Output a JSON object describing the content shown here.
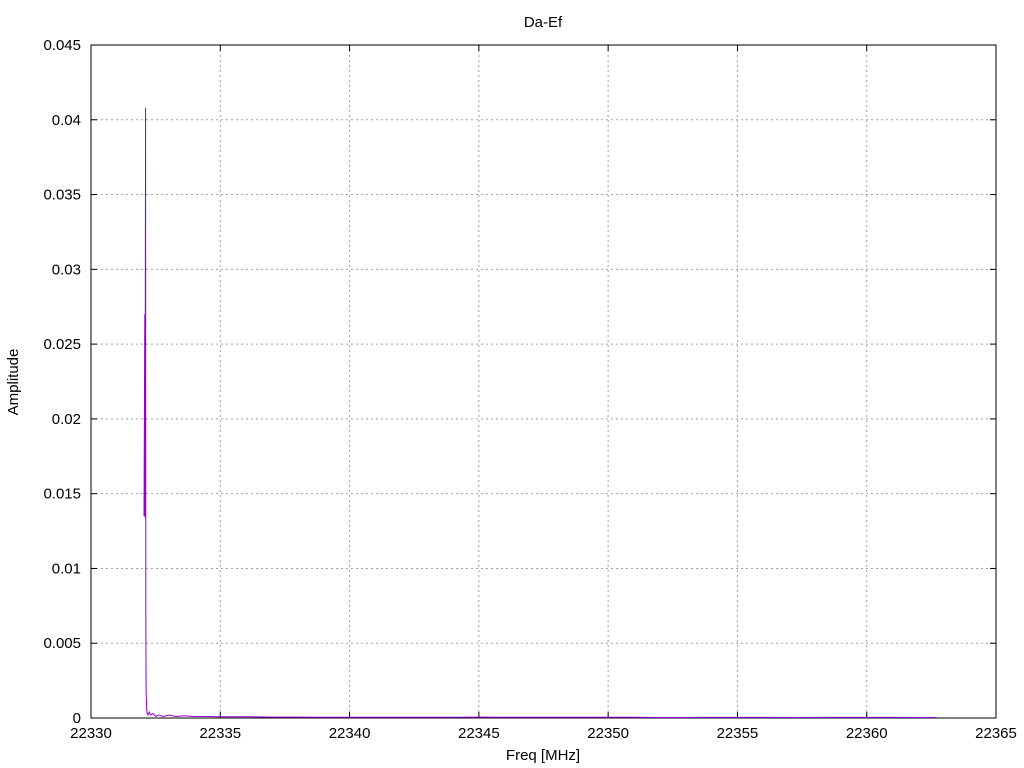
{
  "chart_data": {
    "type": "line",
    "title": "Da-Ef",
    "xlabel": "Freq [MHz]",
    "ylabel": "Amplitude",
    "xlim": [
      22330,
      22365
    ],
    "ylim": [
      0,
      0.045
    ],
    "xticks": [
      22330,
      22335,
      22340,
      22345,
      22350,
      22355,
      22360,
      22365
    ],
    "xtick_labels": [
      "22330",
      "22335",
      "22340",
      "22345",
      "22350",
      "22355",
      "22360",
      "22365"
    ],
    "yticks": [
      0,
      0.005,
      0.01,
      0.015,
      0.02,
      0.025,
      0.03,
      0.035,
      0.04,
      0.045
    ],
    "ytick_labels": [
      "0",
      "0.005",
      "0.01",
      "0.015",
      "0.02",
      "0.025",
      "0.03",
      "0.035",
      "0.04",
      "0.045"
    ],
    "grid": true,
    "line_color": "#9400d3",
    "series": [
      {
        "x": [
          22332.05,
          22332.08,
          22332.09,
          22332.11,
          22332.12,
          22332.13,
          22332.15,
          22332.16,
          22332.18,
          22332.2,
          22332.25,
          22332.3,
          22332.4,
          22332.5,
          22332.6,
          22332.8,
          22333.0,
          22333.3,
          22333.6,
          22334.0,
          22334.5,
          22335.0,
          22336.0,
          22337.0,
          22338.0,
          22339.0,
          22340.0,
          22341.0,
          22342.0,
          22343.0,
          22344.0,
          22345.0,
          22346.0,
          22347.0,
          22348.0,
          22349.0,
          22350.0,
          22351.0,
          22351.8,
          22353.0,
          22353.5,
          22355.0,
          22356.0,
          22357.3,
          22358.5,
          22359.0,
          22360.0,
          22361.0,
          22362.0,
          22362.7
        ],
        "y": [
          0.0135,
          0.027,
          0.0134,
          0.0408,
          0.0066,
          0.0018,
          0.0008,
          0.0004,
          0.0003,
          0.0002,
          0.0004,
          0.0002,
          0.0003,
          0.0001,
          0.0002,
          0.0001,
          0.0002,
          0.0001,
          0.00015,
          0.0001,
          0.0001,
          8e-05,
          8e-05,
          6e-05,
          6e-05,
          5e-05,
          5e-05,
          5e-05,
          5e-05,
          5e-05,
          5e-05,
          6e-05,
          5e-05,
          5e-05,
          5e-05,
          5e-05,
          5e-05,
          5e-05,
          3e-05,
          3e-05,
          4e-05,
          4e-05,
          4e-05,
          3e-05,
          4e-05,
          4e-05,
          4e-05,
          4e-05,
          3e-05,
          3e-05
        ]
      }
    ]
  }
}
